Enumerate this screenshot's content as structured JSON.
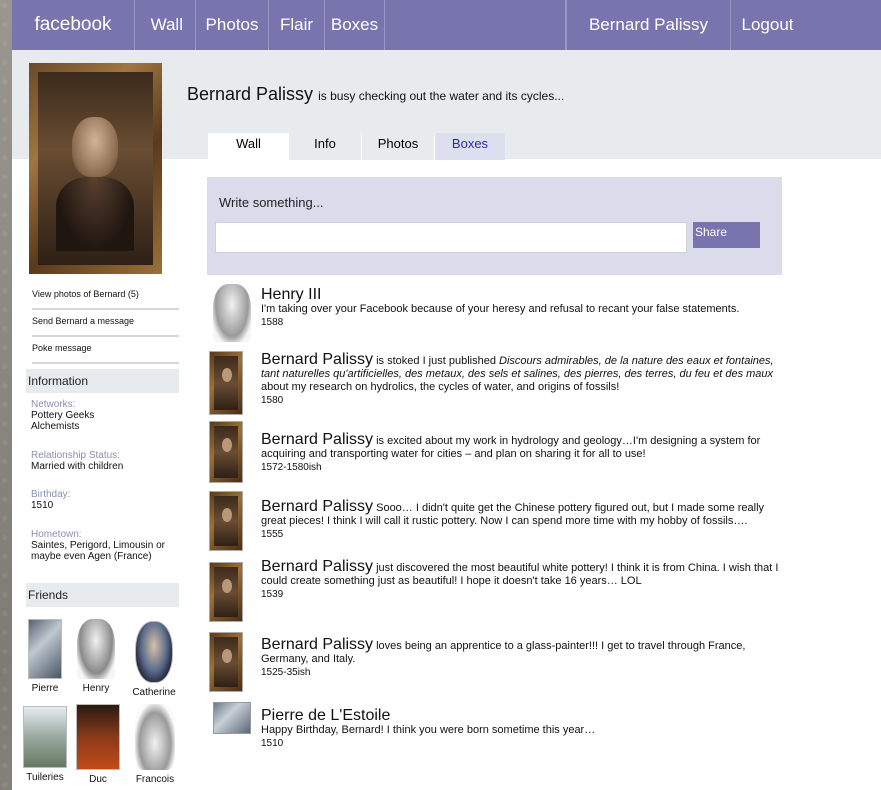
{
  "nav": {
    "logo": "facebook",
    "wall": "Wall",
    "photos": "Photos",
    "flair": "Flair",
    "boxes": "Boxes",
    "user": "Bernard Palissy",
    "logout": "Logout"
  },
  "status": {
    "name": "Bernard Palissy",
    "text": "is busy checking out the water and its cycles..."
  },
  "tabs": {
    "wall": "Wall",
    "info": "Info",
    "photos": "Photos",
    "boxes": "Boxes"
  },
  "sidebar": {
    "links": {
      "view_photos": "View photos of Bernard (5)",
      "send_message": "Send Bernard a message",
      "poke": "Poke message"
    },
    "information_header": "Information",
    "networks_label": "Networks:",
    "networks_1": "Pottery Geeks",
    "networks_2": "Alchemists",
    "relationship_label": "Relationship Status:",
    "relationship_value": "Married with children",
    "birthday_label": "Birthday:",
    "birthday_value": "1510",
    "hometown_label": "Hometown:",
    "hometown_value_1": "Saintes, Perigord, Limousin or",
    "hometown_value_2": "maybe even Agen (France)",
    "friends_header": "Friends",
    "friends": [
      "Pierre",
      "Henry",
      "Catherine",
      "Tuileries",
      "Duc",
      "Francois"
    ]
  },
  "composer": {
    "label": "Write something...",
    "input_value": "",
    "share": "Share"
  },
  "posts": [
    {
      "name": "Henry III",
      "msg": "I'm taking over your Facebook because of your heresy and refusal to recant your false statements.",
      "date": "1588"
    },
    {
      "name": "Bernard Palissy",
      "msg_pre": "is stoked I just published",
      "msg_italic": "Discours admirables, de la nature des eaux et fontaines, tant naturelles qu'artificielles, des metaux, des sels et salines, des pierres, des terres, du feu et des maux",
      "msg_post": "about my research on hydrolics, the cycles of water, and origins of fossils!",
      "date": "1580"
    },
    {
      "name": "Bernard Palissy",
      "msg": "is excited about my work in hydrology and geology…I'm designing a system for acquiring and transporting water for cities – and plan on sharing it for all to use!",
      "date": "1572-1580ish"
    },
    {
      "name": "Bernard Palissy",
      "msg": "Sooo… I didn't quite get the Chinese pottery figured out, but I made some really great pieces! I think I will call it rustic pottery. Now I can spend more time with my hobby of fossils….",
      "date": "1555"
    },
    {
      "name": "Bernard Palissy",
      "msg": "just discovered the most beautiful white pottery! I think it is from China. I wish that I could create something just as beautiful! I hope it doesn't take 16 years… LOL",
      "date": "1539"
    },
    {
      "name": "Bernard Palissy",
      "msg": "loves being an apprentice to a glass-painter!!! I get to travel through France, Germany, and Italy.",
      "date": "1525-35ish"
    },
    {
      "name": "Pierre de L'Estoile",
      "msg": "Happy Birthday, Bernard! I think you were born sometime this year…",
      "date": "1510"
    }
  ],
  "colors": {
    "nav": "#7874ae",
    "band": "#e8ebed",
    "composer": "#dadbeb"
  }
}
